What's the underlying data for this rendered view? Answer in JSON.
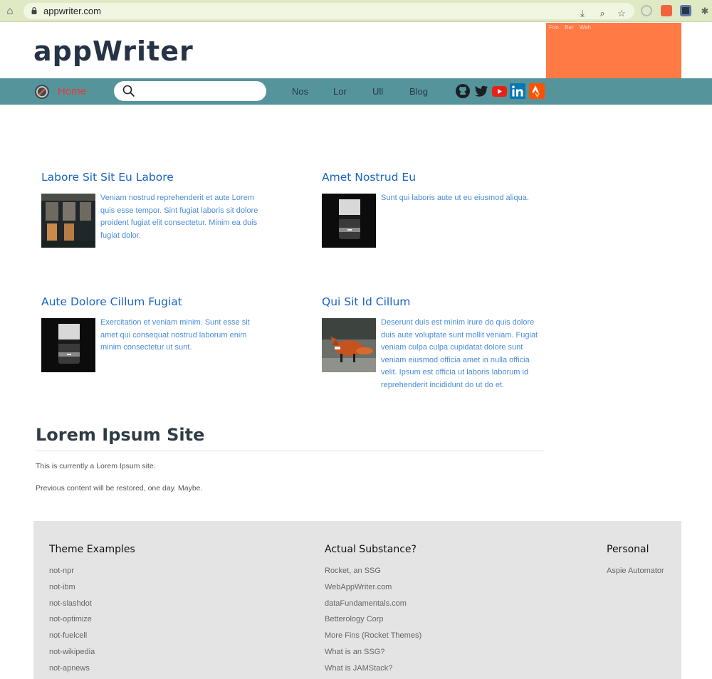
{
  "browser": {
    "url": "appwriter.com"
  },
  "header": {
    "logo": "appWriter",
    "ad_links": [
      "Foo",
      "Bar",
      "Wah"
    ],
    "ad_color": "#ff7a45"
  },
  "nav": {
    "home": "Home",
    "search_placeholder": "",
    "links": [
      "Nos",
      "Lor",
      "Ull",
      "Blog"
    ],
    "bar_color": "#55949b",
    "social_icons": [
      "github-icon",
      "twitter-icon",
      "youtube-icon",
      "linkedin-icon",
      "strava-icon"
    ]
  },
  "articles": [
    {
      "title": "Labore Sit Sit Eu Labore",
      "text": "Veniam nostrud reprehenderit et aute Lorem quis esse tempor. Sint fugiat laboris sit dolore proident fugiat elit consectetur. Minim ea duis fugiat dolor.",
      "image": "building-photo"
    },
    {
      "title": "Amet Nostrud Eu",
      "text": "Sunt qui laboris aute ut eu eiusmod aliqua.",
      "image": "camera-lens-photo"
    },
    {
      "title": "Aute Dolore Cillum Fugiat",
      "text": "Exercitation et veniam minim. Sunt esse sit amet qui consequat nostrud laborum enim minim consectetur ut sunt.",
      "image": "camera-lens-photo"
    },
    {
      "title": "Qui Sit Id Cillum",
      "text": "Deserunt duis est minim irure do quis dolore duis aute voluptate sunt mollit veniam. Fugiat veniam culpa culpa cupidatat dolore sunt veniam eiusmod officia amet in nulla officia velit. Ipsum est officia ut laboris laborum id reprehenderit incididunt do ut do et.",
      "image": "fox-photo"
    }
  ],
  "main": {
    "title": "Lorem Ipsum Site",
    "paragraphs": [
      "This is currently a Lorem Ipsum site.",
      "Previous content will be restored, one day. Maybe."
    ]
  },
  "footer": {
    "columns": [
      {
        "heading": "Theme Examples",
        "items": [
          "not-npr",
          "not-ibm",
          "not-slashdot",
          "not-optimize",
          "not-fuelcell",
          "not-wikipedia",
          "not-apnews"
        ]
      },
      {
        "heading": "Actual Substance?",
        "items": [
          "Rocket, an SSG",
          "WebAppWriter.com",
          "dataFundamentals.com",
          "Betterology Corp",
          "More Fins (Rocket Themes)",
          "What is an SSG?",
          "What is JAMStack?"
        ]
      },
      {
        "heading": "Personal",
        "items": [
          "Aspie Automator"
        ]
      }
    ]
  }
}
